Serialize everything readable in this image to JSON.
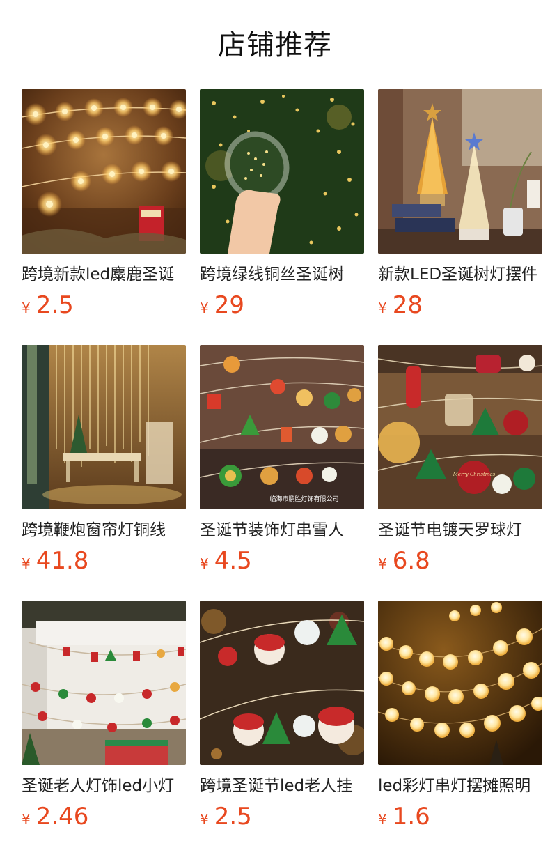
{
  "page": {
    "title": "店铺推荐"
  },
  "products": [
    {
      "name": "跨境新款led麋鹿圣诞",
      "currency": "¥",
      "price": "2.5",
      "image": "snowflake-reindeer-light-string-photo"
    },
    {
      "name": "跨境绿线铜丝圣诞树",
      "currency": "¥",
      "price": "29",
      "image": "copper-wire-spool-photo"
    },
    {
      "name": "新款LED圣诞树灯摆件",
      "currency": "¥",
      "price": "28",
      "image": "led-tree-ornament-photo"
    },
    {
      "name": "跨境鞭炮窗帘灯铜线",
      "currency": "¥",
      "price": "41.8",
      "image": "curtain-light-photo"
    },
    {
      "name": "圣诞节装饰灯串雪人",
      "currency": "¥",
      "price": "4.5",
      "image": "snowman-light-string-photo",
      "watermark": "临海市鹏胜灯饰有限公司"
    },
    {
      "name": "圣诞节电镀天罗球灯",
      "currency": "¥",
      "price": "6.8",
      "image": "ornament-ball-light-photo",
      "ornament_text": "Merry Christmas"
    },
    {
      "name": "圣诞老人灯饰led小灯",
      "currency": "¥",
      "price": "2.46",
      "image": "fireplace-light-string-photo"
    },
    {
      "name": "跨境圣诞节led老人挂",
      "currency": "¥",
      "price": "2.5",
      "image": "santa-light-string-photo"
    },
    {
      "name": "led彩灯串灯摆摊照明",
      "currency": "¥",
      "price": "1.6",
      "image": "globe-ball-light-photo"
    }
  ]
}
